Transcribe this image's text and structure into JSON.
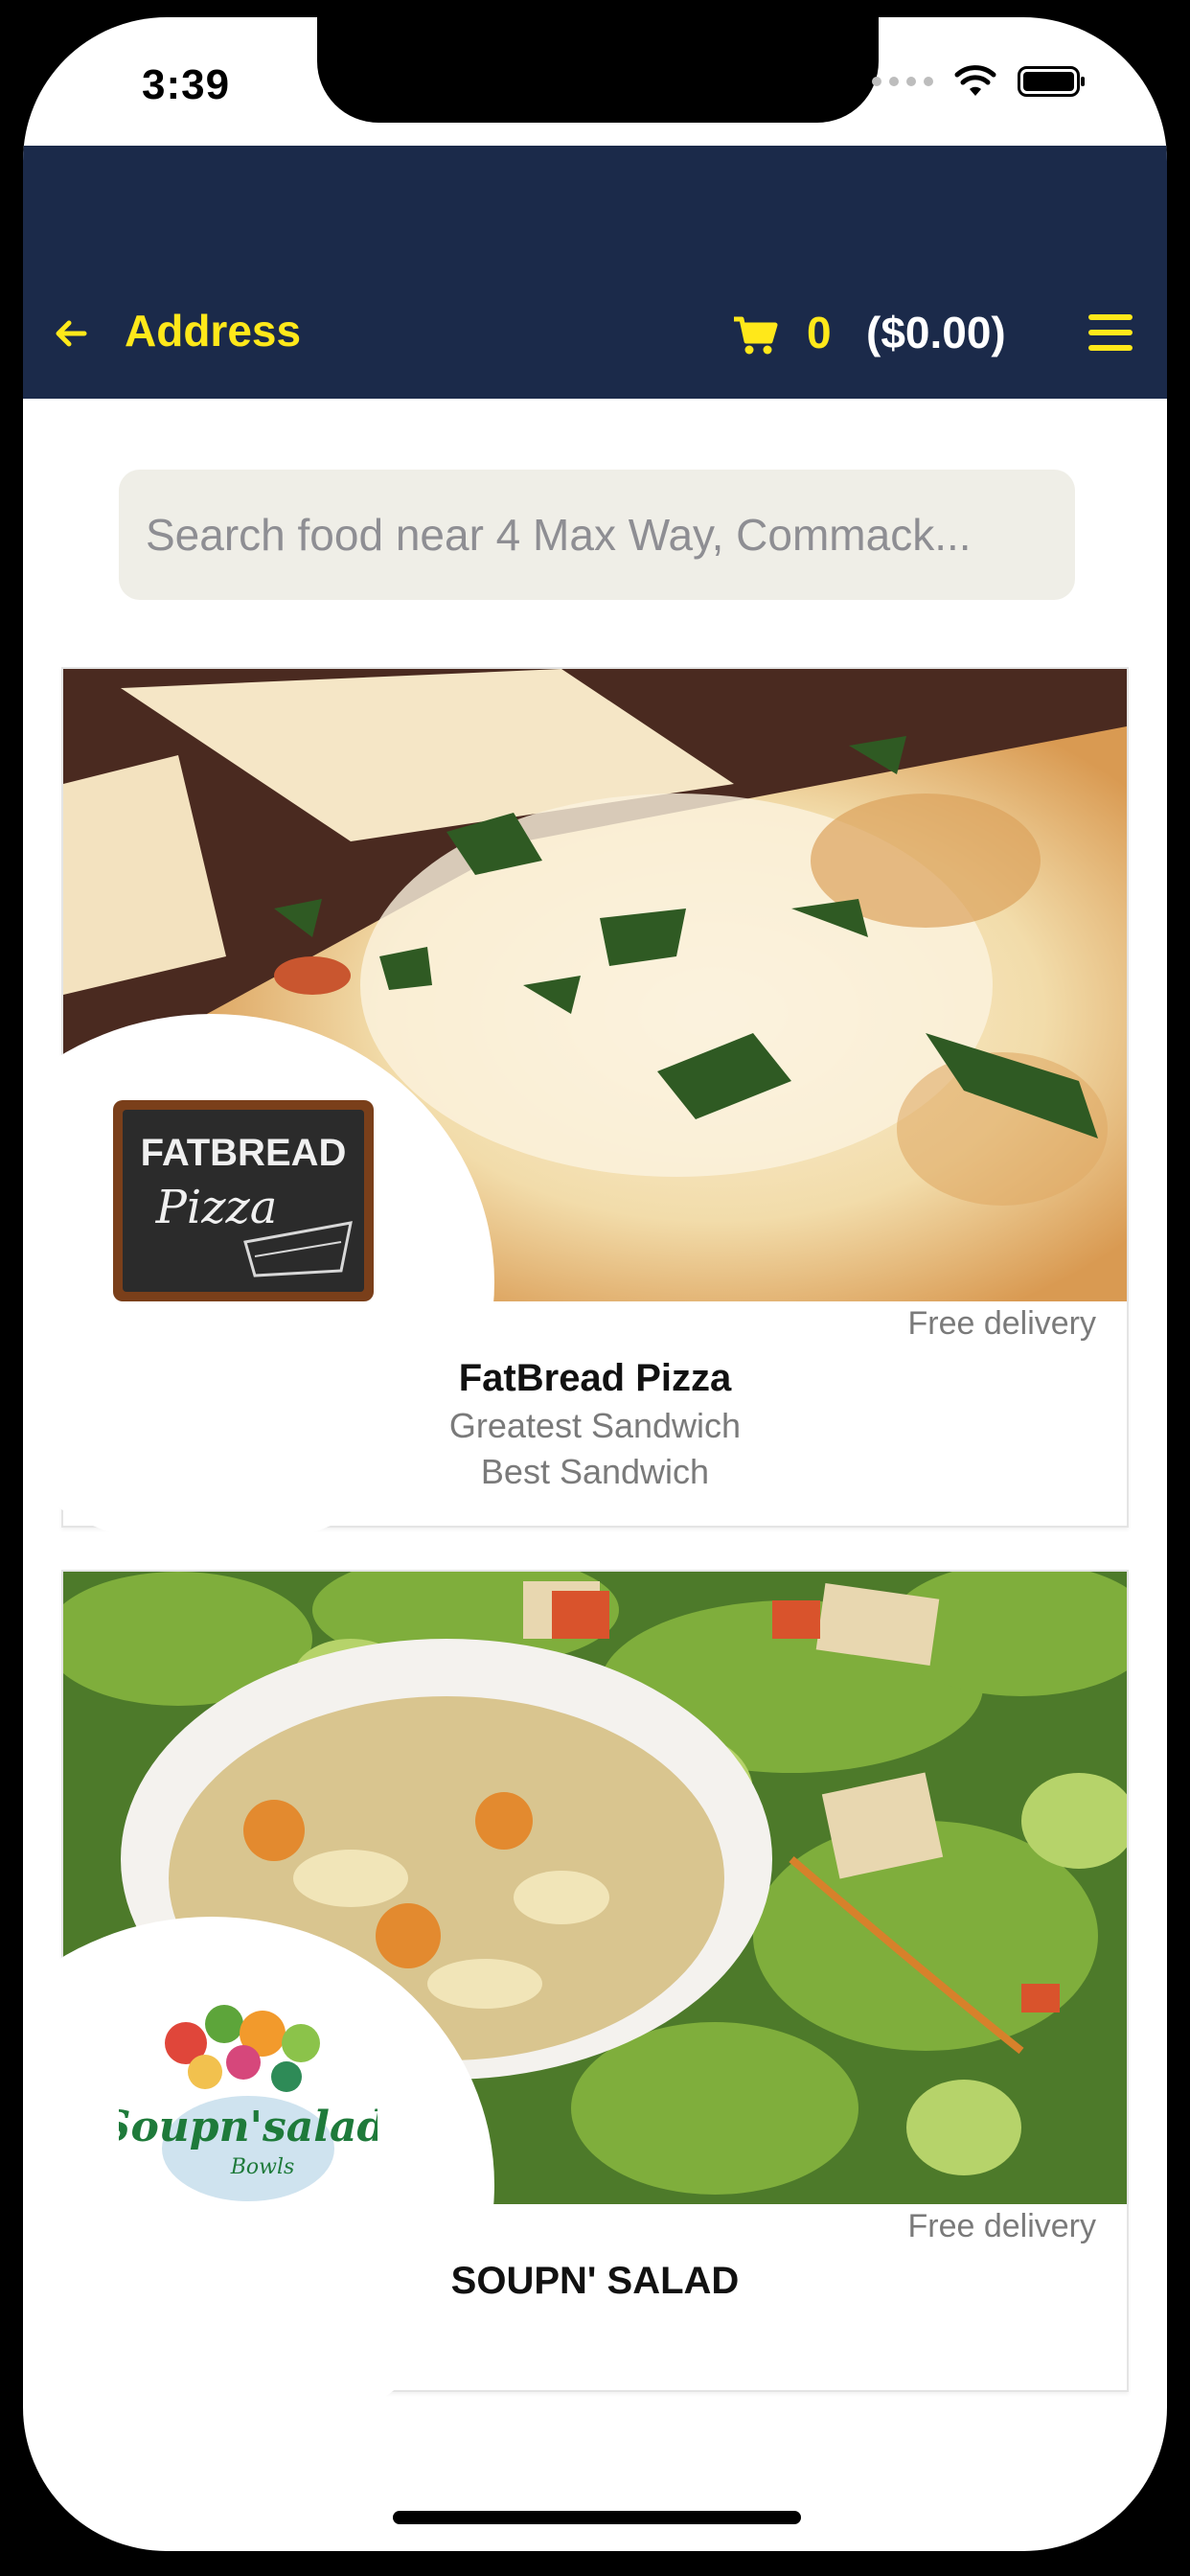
{
  "status_bar": {
    "time": "3:39"
  },
  "header": {
    "back_icon": "arrow-left-icon",
    "title": "Address",
    "cart_icon": "shopping-cart-icon",
    "cart_count": "0",
    "cart_total": "($0.00)",
    "menu_icon": "hamburger-menu-icon"
  },
  "search": {
    "placeholder": "Search food near 4 Max Way, Commack..."
  },
  "restaurants": [
    {
      "name": "FatBread Pizza",
      "tags": [
        "Greatest Sandwich",
        "Best Sandwich"
      ],
      "delivery": "Free delivery",
      "logo_text": "FATBREAD",
      "logo_subtext": "Pizza"
    },
    {
      "name": "SOUPN' SALAD",
      "tags": [],
      "delivery": "Free delivery",
      "logo_text": "Soupn'salad",
      "logo_subtext": "Bowls"
    }
  ],
  "colors": {
    "navbar": "#1b2a4a",
    "accent": "#ffe81a",
    "search_bg": "#efeee7"
  }
}
